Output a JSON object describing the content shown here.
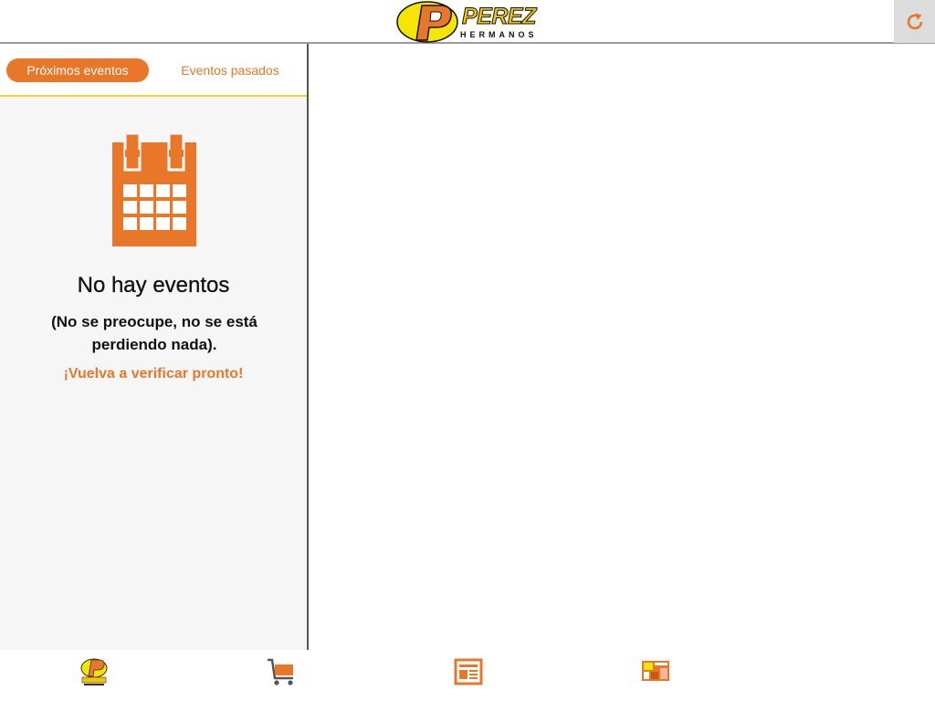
{
  "header": {
    "logo_text": "PEREZ",
    "logo_subtext": "HERMANOS",
    "refresh_icon": "refresh-icon"
  },
  "tabs": {
    "upcoming_label": "Próximos eventos",
    "past_label": "Eventos pasados"
  },
  "empty_state": {
    "icon": "calendar-icon",
    "title": "No hay eventos",
    "message": "(No se preocupe, no se está perdiendo nada).",
    "cta": "¡Vuelva a verificar pronto!"
  },
  "bottom_nav": {
    "items": [
      {
        "icon": "perez-logo-icon"
      },
      {
        "icon": "shopping-cart-icon"
      },
      {
        "icon": "news-icon"
      },
      {
        "icon": "promo-flyer-icon"
      }
    ]
  },
  "colors": {
    "accent": "#e8772a",
    "brand_yellow": "#f2c500",
    "tab_underline": "#f1d337"
  }
}
